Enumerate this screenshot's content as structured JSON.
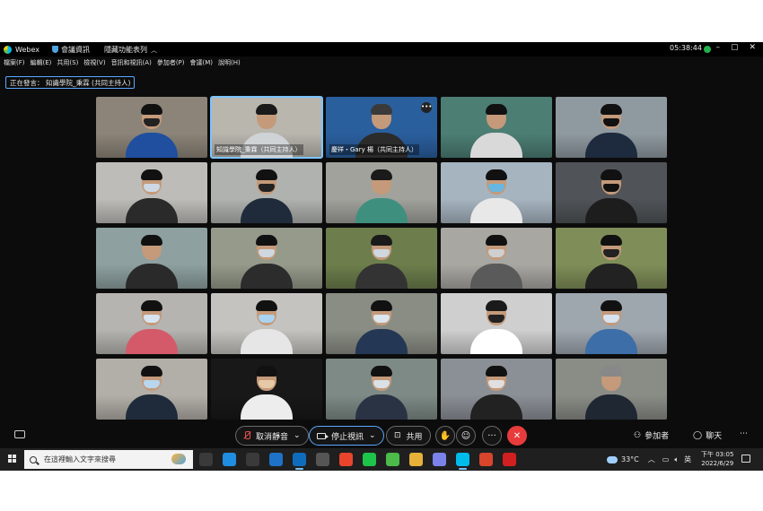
{
  "window": {
    "app_name": "Webex",
    "meeting_info": "會議資訊",
    "hide_menu": "隱藏功能表列",
    "time": "05:38:44",
    "controls": [
      "–",
      "▢",
      "✕"
    ]
  },
  "menu": [
    "檔案(F)",
    "編輯(E)",
    "共用(S)",
    "檢視(V)",
    "音訊和視訊(A)",
    "參加者(P)",
    "會議(M)",
    "說明(H)"
  ],
  "speaker_badge": "正在發言： 知識學院_秉霖 (共同主持人)",
  "tiles": [
    {
      "bg": "#8c8478",
      "shirt": "#1f4f9e",
      "mask": "#222",
      "hair": "#111"
    },
    {
      "bg": "#b9b6ae",
      "shirt": "#cfd3d6",
      "mask": "",
      "hair": "#1a1a1a",
      "label": "知識學院_秉霖（共同主持人）",
      "active": true
    },
    {
      "bg": "#2a5f9e",
      "shirt": "#2b2b2b",
      "mask": "",
      "hair": "#3a3a3a",
      "label": "慶祥・Gary 楊（共同主持人）",
      "more": true
    },
    {
      "bg": "#4c7e74",
      "shirt": "#d9d9d9",
      "mask": "",
      "hair": "#111"
    },
    {
      "bg": "#8f9aa0",
      "shirt": "#1e2a3e",
      "mask": "#111",
      "hair": "#111"
    },
    {
      "bg": "#bdbcb8",
      "shirt": "#2a2a2a",
      "mask": "#cdd8e4",
      "hair": "#111"
    },
    {
      "bg": "#b0b2b0",
      "shirt": "#1f2b3a",
      "mask": "#222",
      "hair": "#111"
    },
    {
      "bg": "#a1a29c",
      "shirt": "#3f8f7e",
      "mask": "",
      "hair": "#1a1a1a"
    },
    {
      "bg": "#a6b4c0",
      "shirt": "#e8e8e8",
      "mask": "#67b7e0",
      "hair": "#111"
    },
    {
      "bg": "#505458",
      "shirt": "#1d1d1d",
      "mask": "#111",
      "hair": "#111"
    },
    {
      "bg": "#8ea0a0",
      "shirt": "#2a2a2a",
      "mask": "",
      "hair": "#111"
    },
    {
      "bg": "#959a8a",
      "shirt": "#2c2c2c",
      "mask": "#cfd7df",
      "hair": "#111"
    },
    {
      "bg": "#6d7e4c",
      "shirt": "#333",
      "mask": "#cfd7df",
      "hair": "#1a1a1a"
    },
    {
      "bg": "#a9a7a2",
      "shirt": "#5a5a5a",
      "mask": "#cfcfcf",
      "hair": "#111"
    },
    {
      "bg": "#7f8e58",
      "shirt": "#222",
      "mask": "#222",
      "hair": "#111"
    },
    {
      "bg": "#b5b4b0",
      "shirt": "#d45a6a",
      "mask": "#d7e3ef",
      "hair": "#111"
    },
    {
      "bg": "#c4c3bf",
      "shirt": "#e6e6e6",
      "mask": "#a9d3f0",
      "hair": "#111"
    },
    {
      "bg": "#8a8d84",
      "shirt": "#243754",
      "mask": "#dbe6ee",
      "hair": "#111"
    },
    {
      "bg": "#cfcfcf",
      "shirt": "#ffffff",
      "mask": "#222",
      "hair": "#1a1a1a"
    },
    {
      "bg": "#9ea6ae",
      "shirt": "#3d6ea8",
      "mask": "#d7e3ef",
      "hair": "#111"
    },
    {
      "bg": "#b2aea8",
      "shirt": "#1f2b3a",
      "mask": "#b8d6ee",
      "hair": "#111"
    },
    {
      "bg": "#181818",
      "shirt": "#ededed",
      "mask": "#e6c9a6",
      "hair": "#111"
    },
    {
      "bg": "#7d8a86",
      "shirt": "#2a3344",
      "mask": "#d9e0e6",
      "hair": "#111"
    },
    {
      "bg": "#8b8f96",
      "shirt": "#222",
      "mask": "#e0e0e0",
      "hair": "#111"
    },
    {
      "bg": "#8a8c86",
      "shirt": "#1f2733",
      "mask": "",
      "hair": "#888"
    }
  ],
  "toolbar": {
    "mute_label": "取消靜音",
    "video_label": "停止視訊",
    "share_label": "共用",
    "participants_label": "參加者",
    "chat_label": "聊天",
    "more_label": "···",
    "end_label": "✕"
  },
  "taskbar": {
    "search_placeholder": "在這裡輸入文字來搜尋",
    "temperature": "33°C",
    "ime": "英",
    "time": "下午 03:05",
    "date": "2022/6/29",
    "apps": [
      {
        "color": "#3a3a3a"
      },
      {
        "color": "#1f8de0"
      },
      {
        "color": "#3a3a3a"
      },
      {
        "color": "#1e73c8"
      },
      {
        "color": "#0f6cbd",
        "on": true
      },
      {
        "color": "#555"
      },
      {
        "color": "#e8452c"
      },
      {
        "color": "#1ec34a"
      },
      {
        "color": "#4cbb4a"
      },
      {
        "color": "#e8b13a"
      },
      {
        "color": "#7b83eb"
      },
      {
        "color": "#00bceb",
        "on": true
      },
      {
        "color": "#d9452c"
      },
      {
        "color": "#d21f1f"
      }
    ]
  }
}
